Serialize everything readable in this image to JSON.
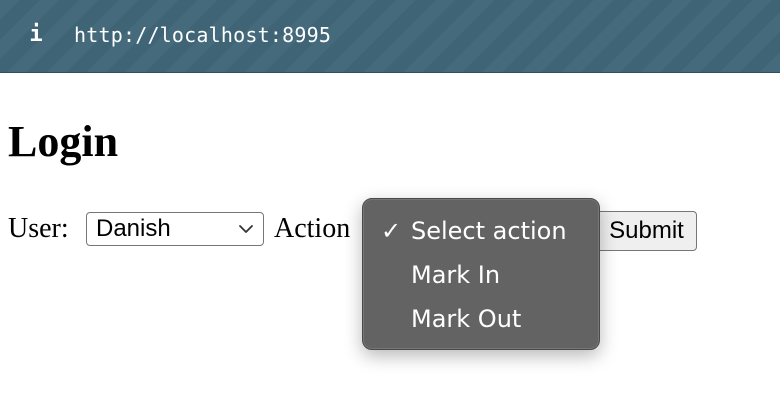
{
  "browser": {
    "url": "http://localhost:8995",
    "info_icon": "i"
  },
  "page": {
    "title": "Login"
  },
  "form": {
    "user_label": "User:",
    "user_selected": "Danish",
    "action_label": "Action",
    "submit_label": "Submit"
  },
  "action_menu": {
    "check_mark": "✓",
    "options": [
      {
        "label": "Select action",
        "selected": true
      },
      {
        "label": "Mark In",
        "selected": false
      },
      {
        "label": "Mark Out",
        "selected": false
      }
    ]
  },
  "colors": {
    "urlbar_background": "#3f6678",
    "dropdown_background": "#636363",
    "button_background": "#efefef"
  }
}
